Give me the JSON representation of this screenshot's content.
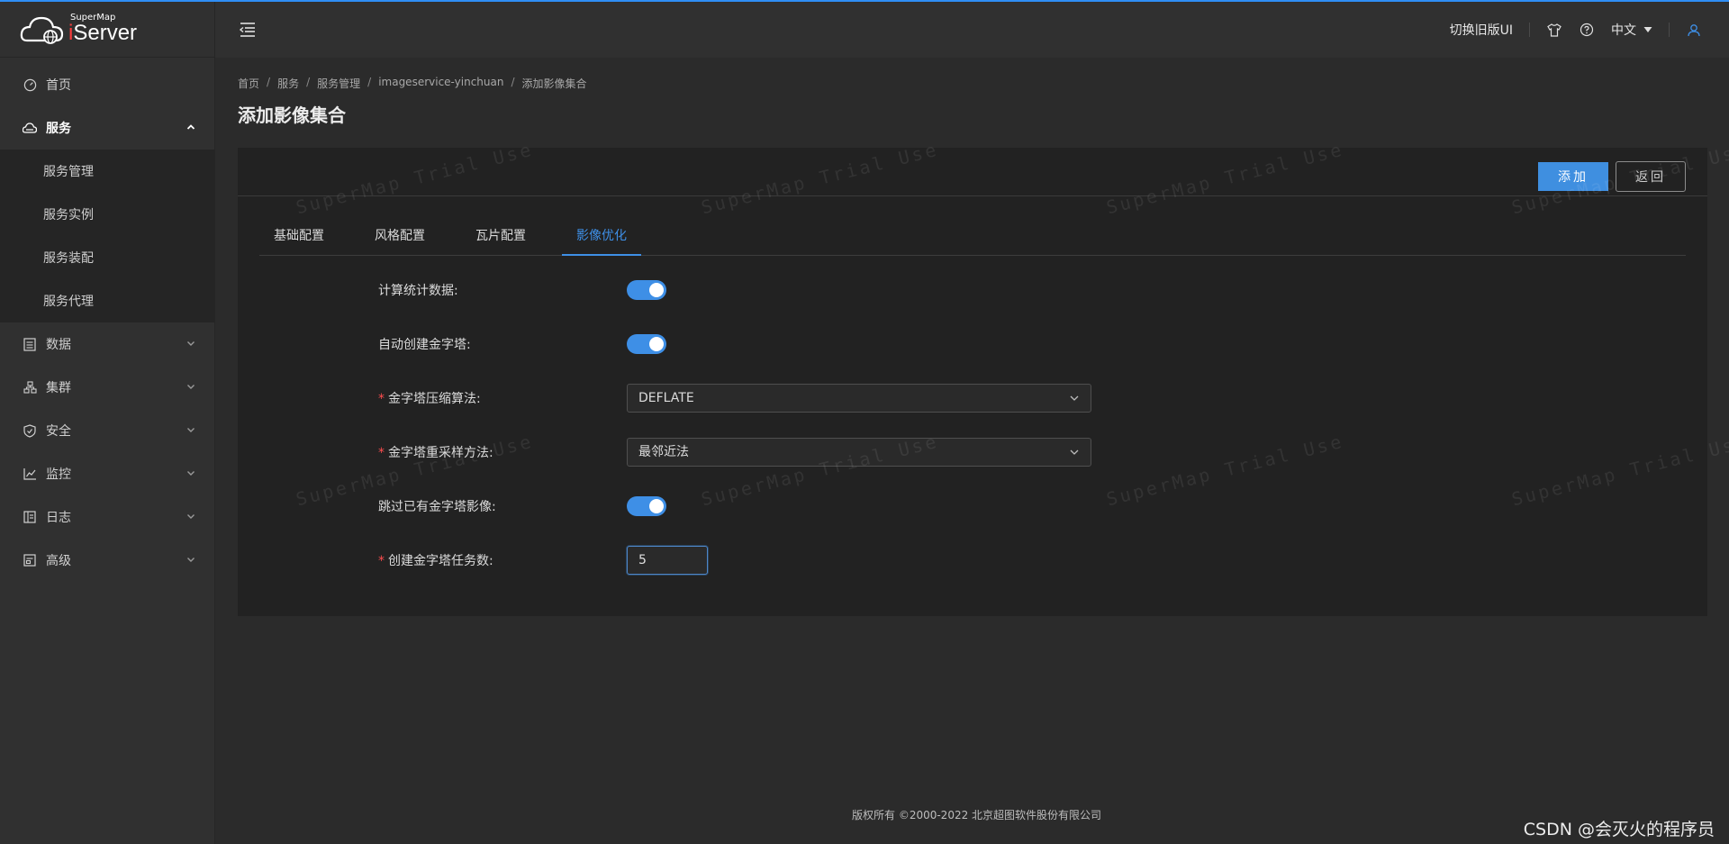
{
  "logo": {
    "small": "SuperMap",
    "big_prefix": "i",
    "big_main": "Server"
  },
  "sidebar": {
    "items": [
      {
        "label": "首页",
        "icon": "dashboard-icon"
      },
      {
        "label": "服务",
        "icon": "cloud-service-icon",
        "expanded": true
      },
      {
        "label": "数据",
        "icon": "data-icon"
      },
      {
        "label": "集群",
        "icon": "cluster-icon"
      },
      {
        "label": "安全",
        "icon": "shield-icon"
      },
      {
        "label": "监控",
        "icon": "monitor-chart-icon"
      },
      {
        "label": "日志",
        "icon": "log-icon"
      },
      {
        "label": "高级",
        "icon": "advanced-icon"
      }
    ],
    "service_sub": [
      "服务管理",
      "服务实例",
      "服务装配",
      "服务代理"
    ]
  },
  "header": {
    "switch_ui": "切换旧版UI",
    "language": "中文"
  },
  "breadcrumb": [
    "首页",
    "服务",
    "服务管理",
    "imageservice-yinchuan",
    "添加影像集合"
  ],
  "page_title": "添加影像集合",
  "toolbar": {
    "add_label": "添加",
    "back_label": "返回"
  },
  "tabs": [
    "基础配置",
    "风格配置",
    "瓦片配置",
    "影像优化"
  ],
  "active_tab": "影像优化",
  "form": {
    "calc_stats": {
      "label": "计算统计数据:",
      "on": true
    },
    "auto_pyramid": {
      "label": "自动创建金字塔:",
      "on": true
    },
    "compress": {
      "label": "金字塔压缩算法:",
      "value": "DEFLATE"
    },
    "resample": {
      "label": "金字塔重采样方法:",
      "value": "最邻近法"
    },
    "skip_existing": {
      "label": "跳过已有金字塔影像:",
      "on": true
    },
    "task_count": {
      "label": "创建金字塔任务数:",
      "value": "5"
    }
  },
  "watermark": "SuperMap Trial Use",
  "footer": "版权所有 ©2000-2022 北京超图软件股份有限公司",
  "csdn": "CSDN @会灭火的程序员",
  "colors": {
    "accent": "#3e8fe6",
    "required": "#ff4d4f"
  }
}
